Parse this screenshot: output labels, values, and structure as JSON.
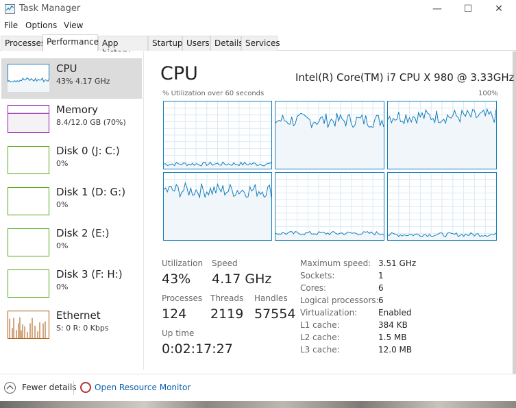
{
  "window": {
    "title": "Task Manager",
    "min": "—",
    "max": "☐",
    "close": "✕"
  },
  "menu": [
    "File",
    "Options",
    "View"
  ],
  "tabs": [
    "Processes",
    "Performance",
    "App history",
    "Startup",
    "Users",
    "Details",
    "Services"
  ],
  "active_tab": "Performance",
  "sidebar": [
    {
      "title": "CPU",
      "sub": "43%  4.17 GHz",
      "color": "#117dbb",
      "level": 0.43
    },
    {
      "title": "Memory",
      "sub": "8.4/12.0 GB (70%)",
      "color": "#8b12ae",
      "level": 0.7
    },
    {
      "title": "Disk 0 (J: C:)",
      "sub": "0%",
      "color": "#4da60c",
      "level": 0.0
    },
    {
      "title": "Disk 1 (D: G:)",
      "sub": "0%",
      "color": "#4da60c",
      "level": 0.0
    },
    {
      "title": "Disk 2 (E:)",
      "sub": "0%",
      "color": "#4da60c",
      "level": 0.0
    },
    {
      "title": "Disk 3 (F: H:)",
      "sub": "0%",
      "color": "#4da60c",
      "level": 0.0
    },
    {
      "title": "Ethernet",
      "sub": "S: 0  R: 0 Kbps",
      "color": "#a74f01",
      "level": 0.0
    }
  ],
  "main": {
    "title": "CPU",
    "cpu_name": "Intel(R) Core(TM) i7 CPU X 980 @ 3.33GHz",
    "util_label": "% Utilization over 60 seconds",
    "pct_max": "100%",
    "graph_levels": [
      0.07,
      0.72,
      0.78,
      0.74,
      0.1,
      0.08
    ]
  },
  "stats": {
    "utilization_label": "Utilization",
    "utilization": "43%",
    "speed_label": "Speed",
    "speed": "4.17 GHz",
    "processes_label": "Processes",
    "processes": "124",
    "threads_label": "Threads",
    "threads": "2119",
    "handles_label": "Handles",
    "handles": "57554",
    "uptime_label": "Up time",
    "uptime": "0:02:17:27"
  },
  "specs": [
    {
      "label": "Maximum speed:",
      "value": "3.51 GHz"
    },
    {
      "label": "Sockets:",
      "value": "1"
    },
    {
      "label": "Cores:",
      "value": "6"
    },
    {
      "label": "Logical processors:",
      "value": "6"
    },
    {
      "label": "Virtualization:",
      "value": "Enabled"
    },
    {
      "label": "L1 cache:",
      "value": "384 KB"
    },
    {
      "label": "L2 cache:",
      "value": "1.5 MB"
    },
    {
      "label": "L3 cache:",
      "value": "12.0 MB"
    }
  ],
  "footer": {
    "fewer": "Fewer details",
    "resmon": "Open Resource Monitor"
  }
}
